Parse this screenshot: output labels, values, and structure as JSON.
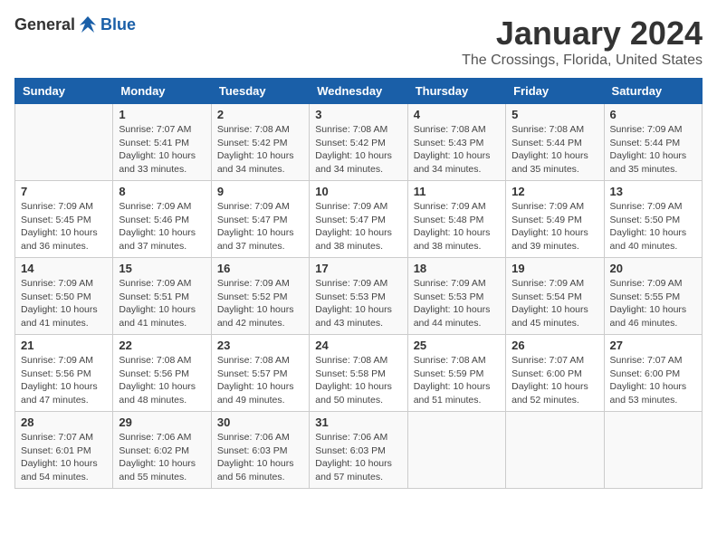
{
  "header": {
    "logo_general": "General",
    "logo_blue": "Blue",
    "month_title": "January 2024",
    "location": "The Crossings, Florida, United States"
  },
  "days_of_week": [
    "Sunday",
    "Monday",
    "Tuesday",
    "Wednesday",
    "Thursday",
    "Friday",
    "Saturday"
  ],
  "weeks": [
    [
      {
        "day": "",
        "info": ""
      },
      {
        "day": "1",
        "info": "Sunrise: 7:07 AM\nSunset: 5:41 PM\nDaylight: 10 hours\nand 33 minutes."
      },
      {
        "day": "2",
        "info": "Sunrise: 7:08 AM\nSunset: 5:42 PM\nDaylight: 10 hours\nand 34 minutes."
      },
      {
        "day": "3",
        "info": "Sunrise: 7:08 AM\nSunset: 5:42 PM\nDaylight: 10 hours\nand 34 minutes."
      },
      {
        "day": "4",
        "info": "Sunrise: 7:08 AM\nSunset: 5:43 PM\nDaylight: 10 hours\nand 34 minutes."
      },
      {
        "day": "5",
        "info": "Sunrise: 7:08 AM\nSunset: 5:44 PM\nDaylight: 10 hours\nand 35 minutes."
      },
      {
        "day": "6",
        "info": "Sunrise: 7:09 AM\nSunset: 5:44 PM\nDaylight: 10 hours\nand 35 minutes."
      }
    ],
    [
      {
        "day": "7",
        "info": "Sunrise: 7:09 AM\nSunset: 5:45 PM\nDaylight: 10 hours\nand 36 minutes."
      },
      {
        "day": "8",
        "info": "Sunrise: 7:09 AM\nSunset: 5:46 PM\nDaylight: 10 hours\nand 37 minutes."
      },
      {
        "day": "9",
        "info": "Sunrise: 7:09 AM\nSunset: 5:47 PM\nDaylight: 10 hours\nand 37 minutes."
      },
      {
        "day": "10",
        "info": "Sunrise: 7:09 AM\nSunset: 5:47 PM\nDaylight: 10 hours\nand 38 minutes."
      },
      {
        "day": "11",
        "info": "Sunrise: 7:09 AM\nSunset: 5:48 PM\nDaylight: 10 hours\nand 38 minutes."
      },
      {
        "day": "12",
        "info": "Sunrise: 7:09 AM\nSunset: 5:49 PM\nDaylight: 10 hours\nand 39 minutes."
      },
      {
        "day": "13",
        "info": "Sunrise: 7:09 AM\nSunset: 5:50 PM\nDaylight: 10 hours\nand 40 minutes."
      }
    ],
    [
      {
        "day": "14",
        "info": "Sunrise: 7:09 AM\nSunset: 5:50 PM\nDaylight: 10 hours\nand 41 minutes."
      },
      {
        "day": "15",
        "info": "Sunrise: 7:09 AM\nSunset: 5:51 PM\nDaylight: 10 hours\nand 41 minutes."
      },
      {
        "day": "16",
        "info": "Sunrise: 7:09 AM\nSunset: 5:52 PM\nDaylight: 10 hours\nand 42 minutes."
      },
      {
        "day": "17",
        "info": "Sunrise: 7:09 AM\nSunset: 5:53 PM\nDaylight: 10 hours\nand 43 minutes."
      },
      {
        "day": "18",
        "info": "Sunrise: 7:09 AM\nSunset: 5:53 PM\nDaylight: 10 hours\nand 44 minutes."
      },
      {
        "day": "19",
        "info": "Sunrise: 7:09 AM\nSunset: 5:54 PM\nDaylight: 10 hours\nand 45 minutes."
      },
      {
        "day": "20",
        "info": "Sunrise: 7:09 AM\nSunset: 5:55 PM\nDaylight: 10 hours\nand 46 minutes."
      }
    ],
    [
      {
        "day": "21",
        "info": "Sunrise: 7:09 AM\nSunset: 5:56 PM\nDaylight: 10 hours\nand 47 minutes."
      },
      {
        "day": "22",
        "info": "Sunrise: 7:08 AM\nSunset: 5:56 PM\nDaylight: 10 hours\nand 48 minutes."
      },
      {
        "day": "23",
        "info": "Sunrise: 7:08 AM\nSunset: 5:57 PM\nDaylight: 10 hours\nand 49 minutes."
      },
      {
        "day": "24",
        "info": "Sunrise: 7:08 AM\nSunset: 5:58 PM\nDaylight: 10 hours\nand 50 minutes."
      },
      {
        "day": "25",
        "info": "Sunrise: 7:08 AM\nSunset: 5:59 PM\nDaylight: 10 hours\nand 51 minutes."
      },
      {
        "day": "26",
        "info": "Sunrise: 7:07 AM\nSunset: 6:00 PM\nDaylight: 10 hours\nand 52 minutes."
      },
      {
        "day": "27",
        "info": "Sunrise: 7:07 AM\nSunset: 6:00 PM\nDaylight: 10 hours\nand 53 minutes."
      }
    ],
    [
      {
        "day": "28",
        "info": "Sunrise: 7:07 AM\nSunset: 6:01 PM\nDaylight: 10 hours\nand 54 minutes."
      },
      {
        "day": "29",
        "info": "Sunrise: 7:06 AM\nSunset: 6:02 PM\nDaylight: 10 hours\nand 55 minutes."
      },
      {
        "day": "30",
        "info": "Sunrise: 7:06 AM\nSunset: 6:03 PM\nDaylight: 10 hours\nand 56 minutes."
      },
      {
        "day": "31",
        "info": "Sunrise: 7:06 AM\nSunset: 6:03 PM\nDaylight: 10 hours\nand 57 minutes."
      },
      {
        "day": "",
        "info": ""
      },
      {
        "day": "",
        "info": ""
      },
      {
        "day": "",
        "info": ""
      }
    ]
  ]
}
